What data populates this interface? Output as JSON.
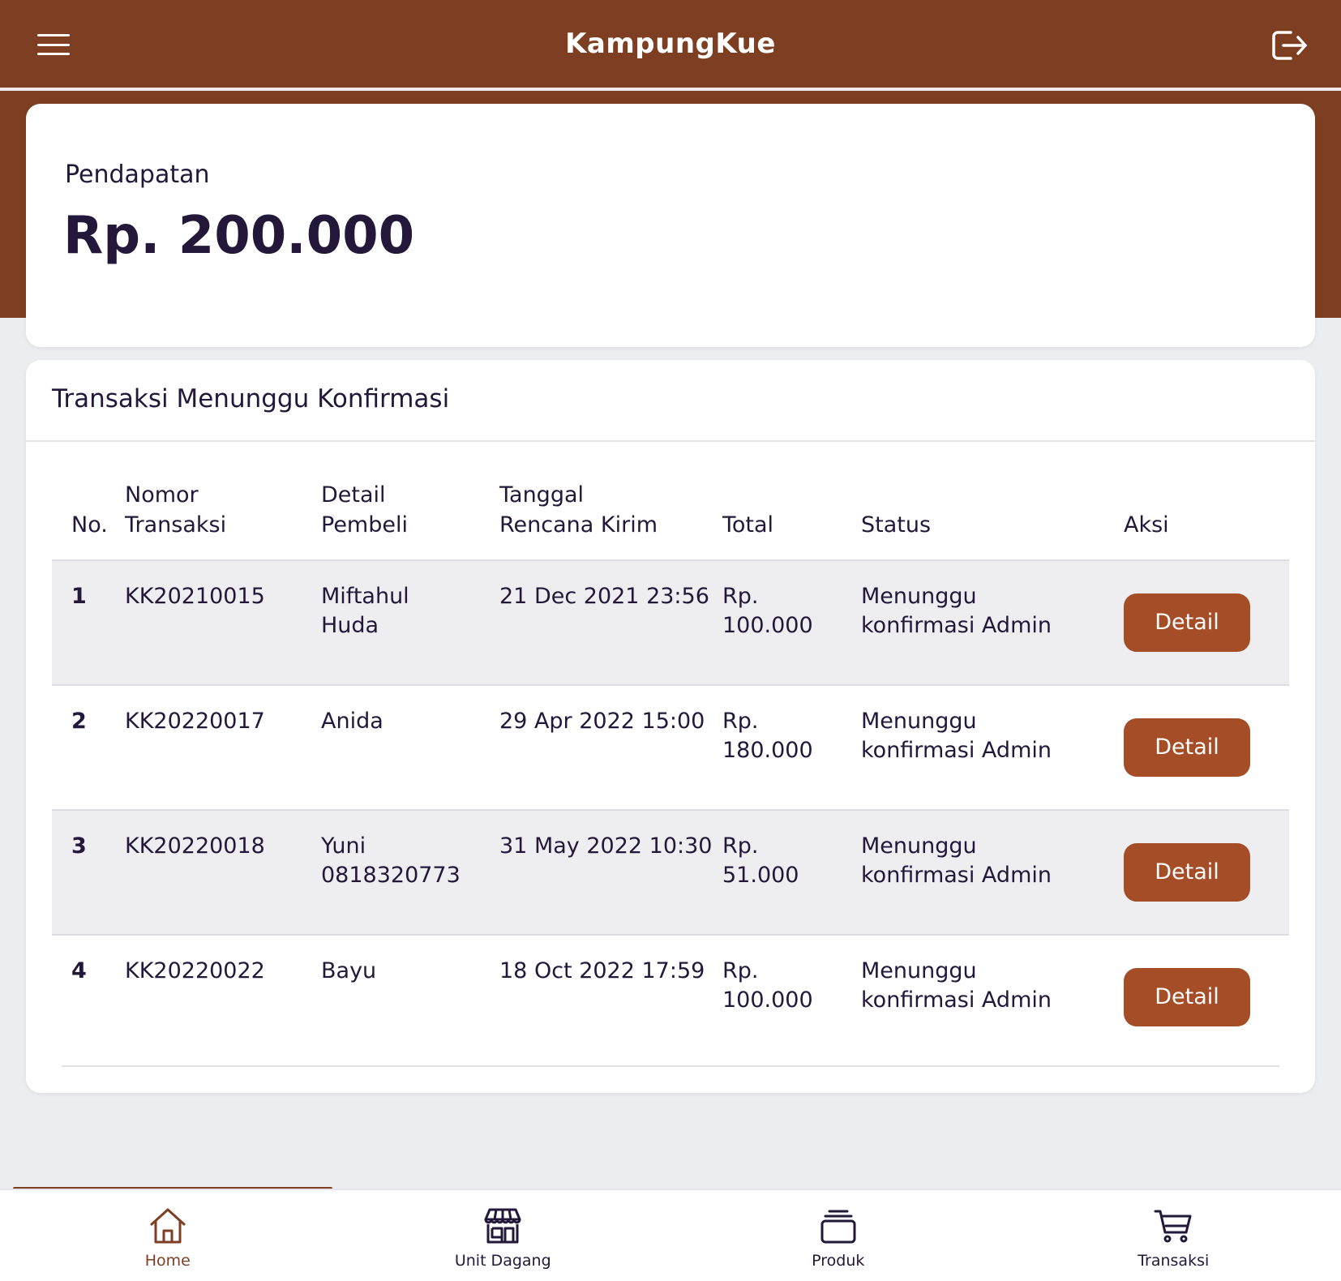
{
  "header": {
    "title": "KampungKue",
    "menu_icon": "hamburger-menu-icon",
    "logout_icon": "logout-icon",
    "background": "#7d3e22"
  },
  "income": {
    "label": "Pendapatan",
    "value": "Rp. 200.000"
  },
  "transactions": {
    "title": "Transaksi Menunggu Konfirmasi",
    "columns": {
      "no": "No.",
      "nomor_1": "Nomor",
      "nomor_2": "Transaksi",
      "detail_1": "Detail",
      "detail_2": "Pembeli",
      "tanggal_1": "Tanggal",
      "tanggal_2": "Rencana Kirim",
      "total": "Total",
      "status": "Status",
      "aksi": "Aksi"
    },
    "rows": [
      {
        "no": "1",
        "nomor": "KK20210015",
        "pembeli_1": "Miftahul",
        "pembeli_2": "Huda",
        "tanggal": "21 Dec 2021 23:56",
        "total_1": "Rp.",
        "total_2": "100.000",
        "status_1": "Menunggu",
        "status_2": "konfirmasi Admin",
        "action": "Detail"
      },
      {
        "no": "2",
        "nomor": "KK20220017",
        "pembeli_1": "Anida",
        "pembeli_2": "",
        "tanggal": "29 Apr 2022 15:00",
        "total_1": "Rp.",
        "total_2": "180.000",
        "status_1": "Menunggu",
        "status_2": "konfirmasi Admin",
        "action": "Detail"
      },
      {
        "no": "3",
        "nomor": "KK20220018",
        "pembeli_1": "Yuni",
        "pembeli_2": "0818320773",
        "tanggal": "31 May 2022 10:30",
        "total_1": "Rp.",
        "total_2": "51.000",
        "status_1": "Menunggu",
        "status_2": "konfirmasi Admin",
        "action": "Detail"
      },
      {
        "no": "4",
        "nomor": "KK20220022",
        "pembeli_1": "Bayu",
        "pembeli_2": "",
        "tanggal": "18 Oct 2022 17:59",
        "total_1": "Rp.",
        "total_2": "100.000",
        "status_1": "Menunggu",
        "status_2": "konfirmasi Admin",
        "action": "Detail"
      }
    ]
  },
  "bottom_nav": {
    "items": [
      {
        "label": "Home",
        "icon": "home-icon",
        "active": true
      },
      {
        "label": "Unit Dagang",
        "icon": "store-icon",
        "active": false
      },
      {
        "label": "Produk",
        "icon": "product-stack-icon",
        "active": false
      },
      {
        "label": "Transaksi",
        "icon": "cart-icon",
        "active": false
      }
    ]
  },
  "colors": {
    "brand": "#7d3e22",
    "button": "#a44d27",
    "text": "#23183a",
    "background": "#ecedf1"
  }
}
